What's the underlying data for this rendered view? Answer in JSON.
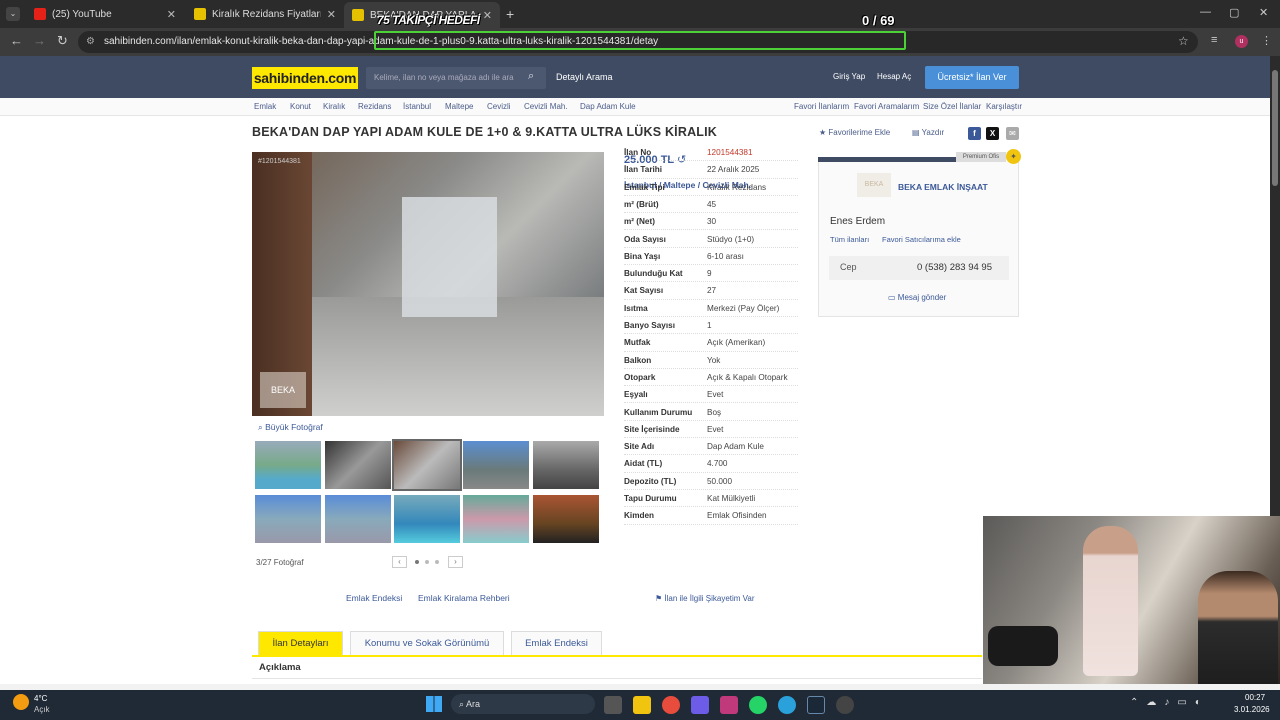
{
  "browser": {
    "tabs": [
      {
        "label": "(25) YouTube",
        "icon": "youtube-icon"
      },
      {
        "label": "Kiralık Rezidans Fiyatları sahibin",
        "icon": "sahibinden-icon"
      },
      {
        "label": "BEKA'DAN DAP YAPI ADAM KU",
        "icon": "sahibinden-icon"
      }
    ],
    "new_tab": "+",
    "url": "sahibinden.com/ilan/emlak-konut-kiralik-beka-dan-dap-yapi-adam-kule-de-1-plus0-9.katta-ultra-luks-kiralik-1201544381/detay",
    "profile_initial": "u"
  },
  "overlay": {
    "title": "75 TAKİPÇİ HEDEFİ",
    "counter": "0 / 69"
  },
  "site": {
    "logo": "sahibinden.com",
    "search_placeholder": "Kelime, ilan no veya mağaza adı ile ara",
    "advanced_search": "Detaylı Arama",
    "login": "Giriş Yap",
    "register": "Hesap Aç",
    "post_ad": "Ücretsiz* İlan Ver"
  },
  "breadcrumbs": [
    "Emlak",
    "Konut",
    "Kiralık",
    "Rezidans",
    "İstanbul",
    "Maltepe",
    "Cevizli",
    "Cevizli Mah.",
    "Dap Adam Kule"
  ],
  "quick_links": [
    "Favori İlanlarım",
    "Favori Aramalarım",
    "Size Özel İlanlar",
    "Karşılaştır"
  ],
  "listing": {
    "title": "BEKA'DAN DAP YAPI ADAM KULE DE 1+0 & 9.KATTA ULTRA LÜKS KİRALIK",
    "favorite": "Favorilerime Ekle",
    "print": "Yazdır",
    "photo_id": "#1201544381",
    "watermark": "BEKA",
    "big_photo": "Büyük Fotoğraf",
    "photo_count": "3/27 Fotoğraf",
    "price": "25.000 TL",
    "location": [
      "İstanbul",
      "Maltepe",
      "Cevizli Mah."
    ],
    "details": [
      {
        "k": "İlan No",
        "v": "1201544381",
        "red": true
      },
      {
        "k": "İlan Tarihi",
        "v": "22 Aralık 2025"
      },
      {
        "k": "Emlak Tipi",
        "v": "Kiralık Rezidans"
      },
      {
        "k": "m² (Brüt)",
        "v": "45"
      },
      {
        "k": "m² (Net)",
        "v": "30"
      },
      {
        "k": "Oda Sayısı",
        "v": "Stüdyo (1+0)"
      },
      {
        "k": "Bina Yaşı",
        "v": "6-10 arası"
      },
      {
        "k": "Bulunduğu Kat",
        "v": "9"
      },
      {
        "k": "Kat Sayısı",
        "v": "27"
      },
      {
        "k": "Isıtma",
        "v": "Merkezi (Pay Ölçer)"
      },
      {
        "k": "Banyo Sayısı",
        "v": "1"
      },
      {
        "k": "Mutfak",
        "v": "Açık (Amerikan)"
      },
      {
        "k": "Balkon",
        "v": "Yok"
      },
      {
        "k": "Otopark",
        "v": "Açık & Kapalı Otopark"
      },
      {
        "k": "Eşyalı",
        "v": "Evet"
      },
      {
        "k": "Kullanım Durumu",
        "v": "Boş"
      },
      {
        "k": "Site İçerisinde",
        "v": "Evet"
      },
      {
        "k": "Site Adı",
        "v": "Dap Adam Kule"
      },
      {
        "k": "Aidat (TL)",
        "v": "4.700"
      },
      {
        "k": "Depozito (TL)",
        "v": "50.000"
      },
      {
        "k": "Tapu Durumu",
        "v": "Kat Mülkiyetli"
      },
      {
        "k": "Kimden",
        "v": "Emlak Ofisinden"
      }
    ],
    "links": [
      "Emlak Endeksi",
      "Emlak Kiralama Rehberi"
    ],
    "complaint": "İlan ile İlgili Şikayetim Var"
  },
  "seller": {
    "premium": "Premium Ofis",
    "logo_text": "BEKA",
    "agency": "BEKA EMLAK İNŞAAT",
    "agent": "Enes Erdem",
    "all_ads": "Tüm ilanları",
    "fav_seller": "Favori Satıcılarıma ekle",
    "phone_label": "Cep",
    "phone": "0 (538) 283 94 95",
    "message": "Mesaj gönder"
  },
  "bottom_tabs": [
    "İlan Detayları",
    "Konumu ve Sokak Görünümü",
    "Emlak Endeksi"
  ],
  "section_title": "Açıklama",
  "taskbar": {
    "weather_temp": "4°C",
    "weather_desc": "Açık",
    "search": "Ara",
    "time": "00:27",
    "date": "3.01.2026"
  },
  "colors": {
    "accent": "#ffe800",
    "header": "#3e4b62",
    "link": "#3b5998",
    "highlight": "#4cd137"
  }
}
